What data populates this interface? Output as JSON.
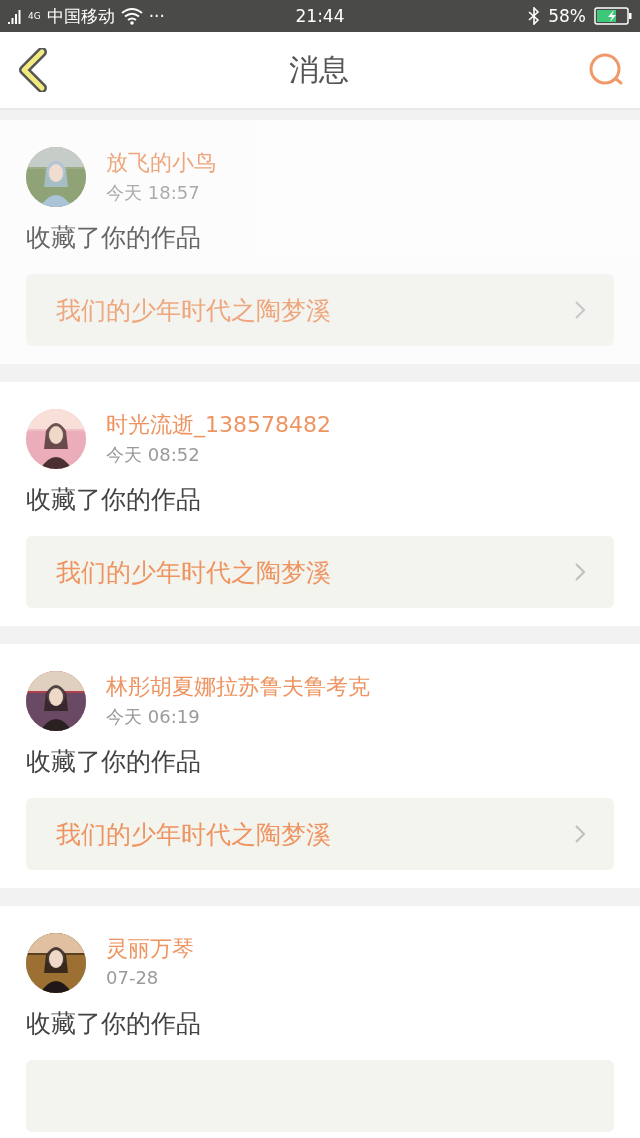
{
  "status_bar": {
    "network": "4G",
    "carrier": "中国移动",
    "more": "···",
    "time": "21:44",
    "battery": "58%",
    "charging": true
  },
  "header": {
    "title": "消息"
  },
  "messages": [
    {
      "name": "放飞的小鸟",
      "time": "今天 18:57",
      "action": "收藏了你的作品",
      "link": "我们的少年时代之陶梦溪",
      "dimmed": true
    },
    {
      "name": "时光流逝_138578482",
      "time": "今天 08:52",
      "action": "收藏了你的作品",
      "link": "我们的少年时代之陶梦溪",
      "dimmed": false
    },
    {
      "name": "林彤胡夏娜拉苏鲁夫鲁考克",
      "time": "今天 06:19",
      "action": "收藏了你的作品",
      "link": "我们的少年时代之陶梦溪",
      "dimmed": false
    },
    {
      "name": "灵丽万琴",
      "time": "07-28",
      "action": "收藏了你的作品",
      "dimmed": false
    }
  ]
}
